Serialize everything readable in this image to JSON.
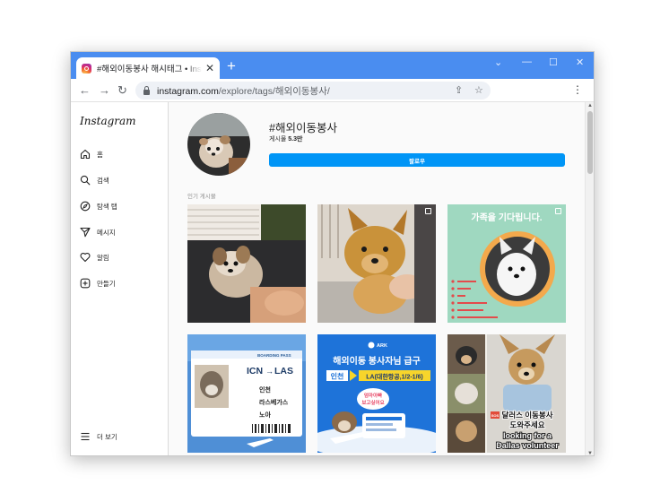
{
  "browser": {
    "tab_title": "#해외이동봉사 해시태그 • Instagram",
    "tab_close": "✕",
    "new_tab": "+",
    "win_minimize": "—",
    "win_maximize": "☐",
    "win_close": "✕",
    "win_extra": "⌄",
    "back": "←",
    "forward": "→",
    "reload": "↻",
    "url_host": "instagram.com",
    "url_path": "/explore/tags/해외이동봉사/",
    "share": "⇪",
    "bookmark": "☆",
    "menu": "⋮"
  },
  "sidebar": {
    "logo": "Instagram",
    "items": [
      {
        "label": "홈",
        "icon": "home-icon"
      },
      {
        "label": "검색",
        "icon": "search-icon"
      },
      {
        "label": "탐색 탭",
        "icon": "compass-icon"
      },
      {
        "label": "메시지",
        "icon": "send-icon"
      },
      {
        "label": "알림",
        "icon": "heart-icon"
      },
      {
        "label": "만들기",
        "icon": "plus-square-icon"
      }
    ],
    "more": {
      "label": "더 보기",
      "icon": "hamburger-icon"
    }
  },
  "header": {
    "hashtag": "#해외이동봉사",
    "posts_label": "게시물",
    "posts_count": "5.3만",
    "follow_label": "팔로우"
  },
  "grid": {
    "section_label": "인기 게시물",
    "tile3": {
      "text": "가족을 기다립니다."
    },
    "tile4": {
      "header": "BOARDING PASS",
      "from": "ICN",
      "to": "LAS",
      "arrow": "→",
      "city1": "인천",
      "city2": "라스베가스",
      "name": "노아"
    },
    "tile5": {
      "brand": "ARK",
      "title": "해외이동 봉사자님 급구",
      "route_from": "인천",
      "route_to": "LA(대한항공,1/2-1/6)",
      "bubble": "엄마아빠\n보고싶어요"
    },
    "tile6": {
      "sos": "SOS",
      "ko_line1": "달러스 이동봉사",
      "ko_line2": "도와주세요",
      "en_line1": "looking for a",
      "en_line2": "Dallas volunteer"
    }
  },
  "colors": {
    "chrome_blue": "#4a8df0",
    "follow_blue": "#0095f6",
    "tile3_bg": "#9fd8c0",
    "tile4_bg": "#4f8fd6",
    "tile5_bg": "#1e73d9"
  }
}
